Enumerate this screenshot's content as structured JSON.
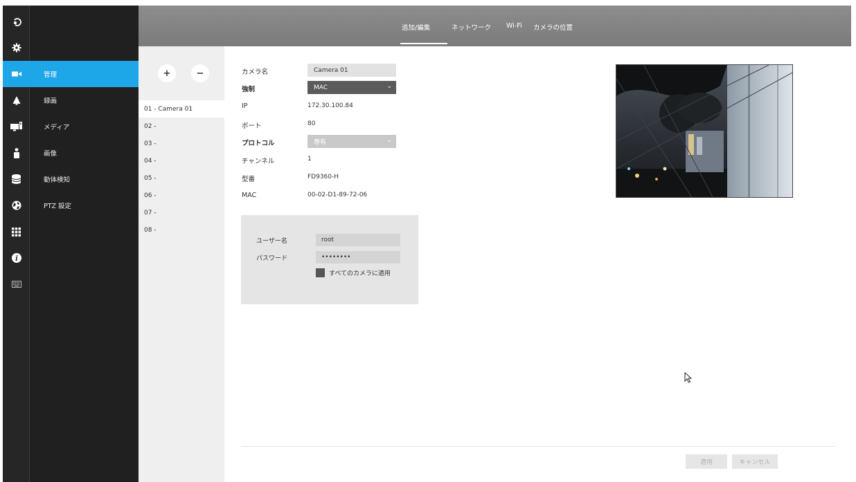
{
  "header": {
    "tabs": [
      {
        "label": "追加/編集",
        "active": true
      },
      {
        "label": "ネットワーク",
        "active": false
      },
      {
        "label": "Wi-Fi",
        "active": false
      },
      {
        "label": "カメラの位置",
        "active": false
      }
    ]
  },
  "rail": {
    "icons": [
      "playback-icon",
      "settings-gear-icon",
      "video-camera-icon",
      "alert-bell-icon",
      "monitor-icon",
      "user-icon",
      "storage-icon",
      "network-globe-icon",
      "apps-grid-icon",
      "info-icon",
      "keyboard-icon"
    ],
    "active_index": 2
  },
  "menu": {
    "items": [
      {
        "label": "管理",
        "active": true
      },
      {
        "label": "録画",
        "active": false
      },
      {
        "label": "メディア",
        "active": false
      },
      {
        "label": "画像",
        "active": false
      },
      {
        "label": "動体検知",
        "active": false
      },
      {
        "label": "PTZ 設定",
        "active": false
      }
    ]
  },
  "camera_list": {
    "add_label": "+",
    "remove_label": "−",
    "items": [
      {
        "label": "01 - Camera 01",
        "selected": true
      },
      {
        "label": "02 -",
        "selected": false
      },
      {
        "label": "03 -",
        "selected": false
      },
      {
        "label": "04 -",
        "selected": false
      },
      {
        "label": "05 -",
        "selected": false
      },
      {
        "label": "06 -",
        "selected": false
      },
      {
        "label": "07 -",
        "selected": false
      },
      {
        "label": "08 -",
        "selected": false
      }
    ]
  },
  "form": {
    "camera_name": {
      "label": "カメラ名",
      "value": "Camera 01"
    },
    "force": {
      "label": "強制",
      "value": "MAC"
    },
    "ip": {
      "label": "IP",
      "value": "172.30.100.84"
    },
    "port": {
      "label": "ポート",
      "value": "80"
    },
    "protocol": {
      "label": "プロトコル",
      "value": "専有"
    },
    "channel": {
      "label": "チャンネル",
      "value": "1"
    },
    "model": {
      "label": "型番",
      "value": "FD9360-H"
    },
    "mac": {
      "label": "MAC",
      "value": "00-02-D1-89-72-06"
    }
  },
  "credentials": {
    "username_label": "ユーザー名",
    "username_value": "root",
    "password_label": "パスワード",
    "password_value": "••••••••",
    "apply_all_label": "すべてのカメラに適用"
  },
  "footer": {
    "apply_label": "適用",
    "cancel_label": "キャンセル"
  },
  "colors": {
    "accent": "#1ea7e8",
    "rail_bg": "#262626",
    "menu_bg": "#202020",
    "header_bg": "#828282",
    "force_select_bg": "#5b5b5b",
    "protocol_select_bg": "#c9c9c9"
  }
}
